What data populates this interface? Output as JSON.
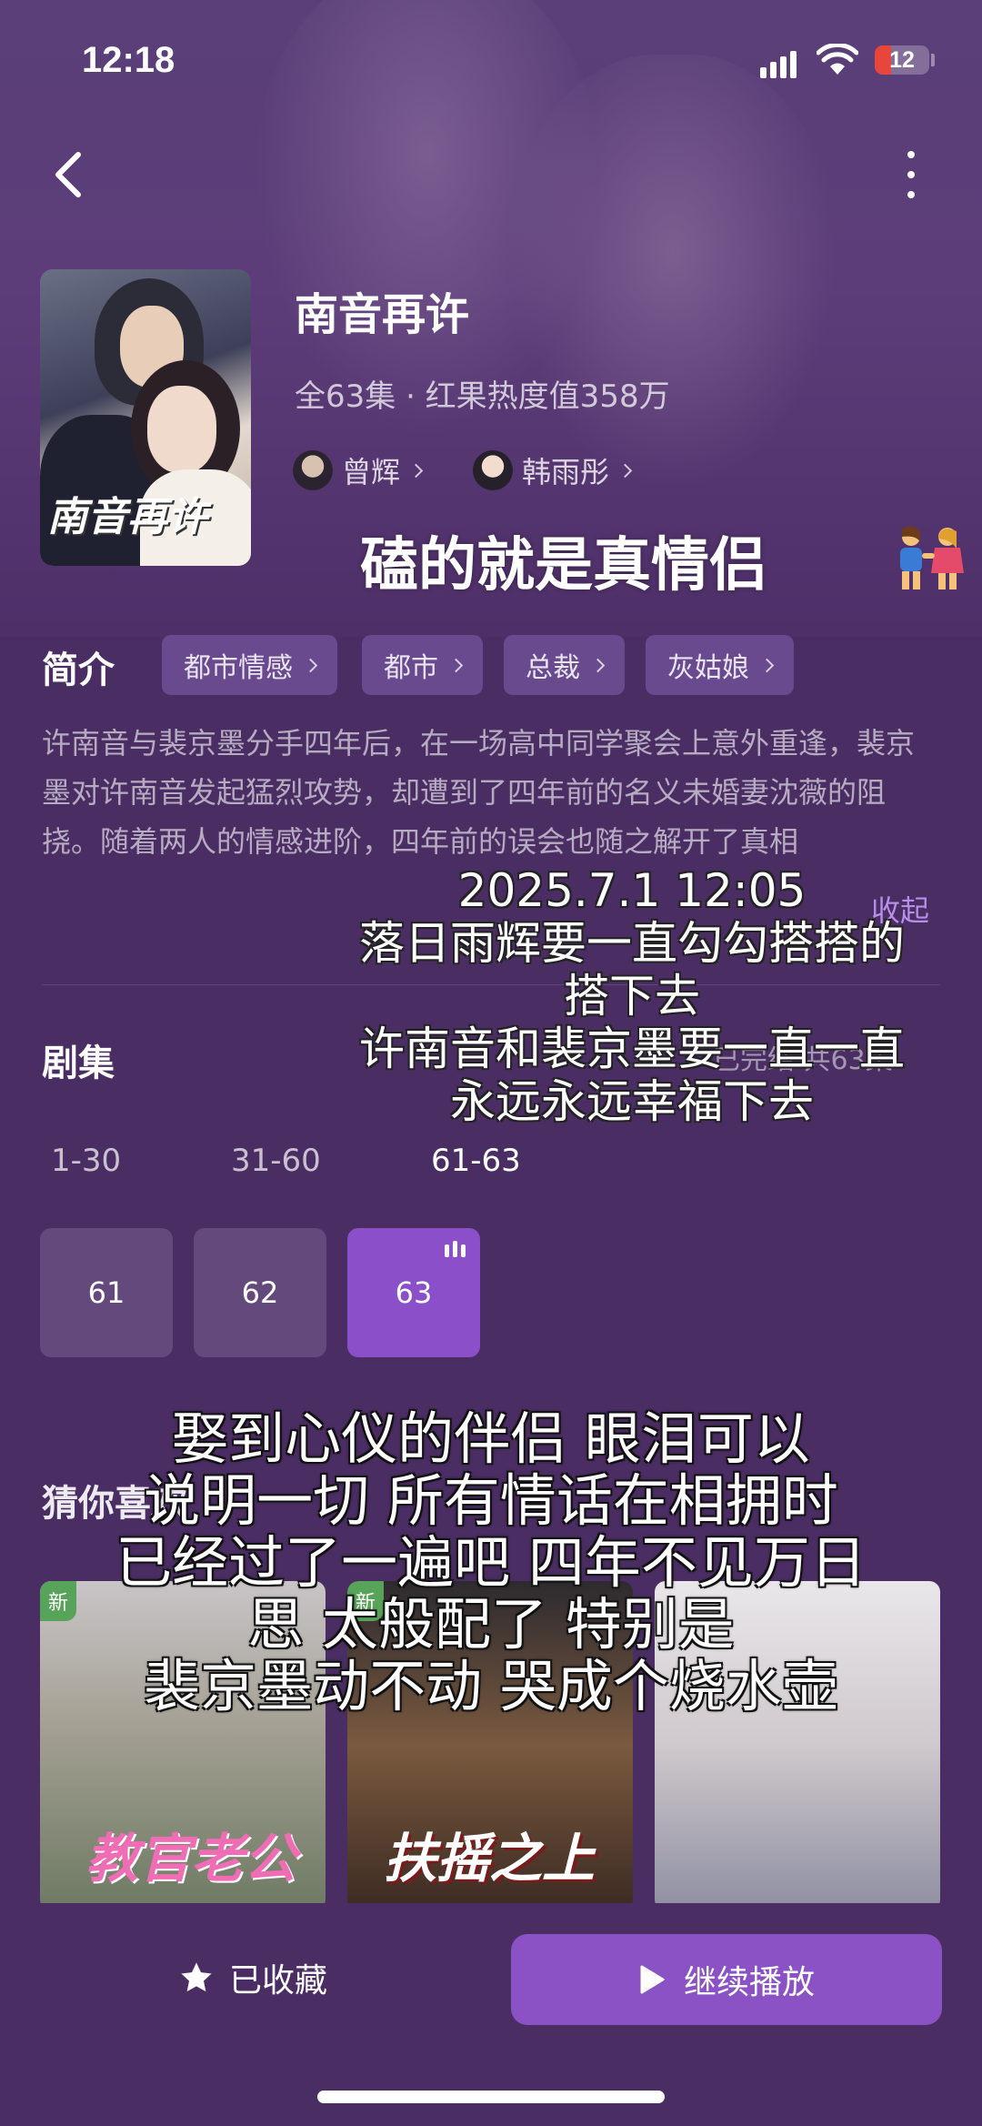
{
  "status_bar": {
    "time": "12:18",
    "battery": "12",
    "battery_level": 0.12
  },
  "show": {
    "poster_title": "南音再许",
    "title": "南音再许",
    "meta": "全63集 · 红果热度值358万",
    "actors": [
      {
        "name": "曾辉"
      },
      {
        "name": "韩雨彤"
      }
    ]
  },
  "overlay": {
    "caption_top": "磕的就是真情侣",
    "caption_mid": [
      "2025.7.1 12:05",
      "落日雨辉要一直勾勾搭搭的",
      "搭下去",
      "许南音和裴京墨要一直一直",
      "永远永远幸福下去"
    ],
    "caption_bottom": [
      "娶到心仪的伴侣 眼泪可以",
      "说明一切 所有情话在相拥时",
      "已经过了一遍吧 四年不见万日",
      "思 太般配了 特别是",
      "裴京墨动不动 哭成个烧水壶"
    ]
  },
  "intro": {
    "label": "简介",
    "tags": [
      {
        "label": "都市情感"
      },
      {
        "label": "都市"
      },
      {
        "label": "总裁"
      },
      {
        "label": "灰姑娘"
      }
    ],
    "description": "许南音与裴京墨分手四年后，在一场高中同学聚会上意外重逢，裴京墨对许南音发起猛烈攻势，却遭到了四年前的名义未婚妻沈薇的阻挠。随着两人的情感进阶，四年前的误会也随之解开了真相",
    "collapse": "收起"
  },
  "episodes": {
    "label": "剧集",
    "status": "已完结 共63集",
    "ranges": [
      "1-30",
      "31-60",
      "61-63"
    ],
    "active_range": 2,
    "items": [
      "61",
      "62",
      "63"
    ],
    "playing": "63"
  },
  "recommend": {
    "label": "猜你喜欢",
    "cards": [
      {
        "badge": "新",
        "title": "教官老公"
      },
      {
        "badge": "新",
        "title": "扶摇之上"
      },
      {
        "badge": "",
        "title": ""
      }
    ]
  },
  "bottom": {
    "favorite_label": "已收藏",
    "play_label": "继续播放"
  },
  "colors": {
    "background": "#4a2d63",
    "accent": "#8a52c4",
    "tag_bg": "#6a4a8e",
    "episode_bg": "#63497c",
    "link": "#b88fe8"
  }
}
